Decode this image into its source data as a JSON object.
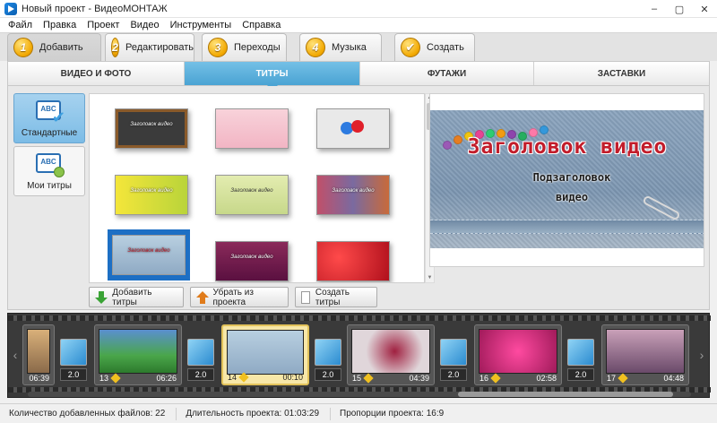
{
  "window": {
    "title": "Новый проект - ВидеоМОНТАЖ",
    "minimize": "–",
    "maximize": "▢",
    "close": "✕"
  },
  "menu": [
    "Файл",
    "Правка",
    "Проект",
    "Видео",
    "Инструменты",
    "Справка"
  ],
  "steps": [
    {
      "num": "1",
      "label": "Добавить"
    },
    {
      "num": "2",
      "label": "Редактировать"
    },
    {
      "num": "3",
      "label": "Переходы"
    },
    {
      "num": "4",
      "label": "Музыка"
    },
    {
      "num": "✔",
      "label": "Создать"
    }
  ],
  "categories": [
    "ВИДЕО И ФОТО",
    "ТИТРЫ",
    "ФУТАЖИ",
    "ЗАСТАВКИ"
  ],
  "active_category": "ТИТРЫ",
  "sidebar": [
    {
      "label": "Стандартные",
      "icon_text": "ABC",
      "active": true
    },
    {
      "label": "Мои титры",
      "icon_text": "ABC",
      "active": false
    }
  ],
  "thumbnails": [
    {
      "caption": "Заголовок видео",
      "bg": "#3b3b3b"
    },
    {
      "caption": "",
      "bg": "#f6c6d0"
    },
    {
      "caption": "",
      "bg": "#e9e9e9"
    },
    {
      "caption": "Заголовок видео",
      "bg": "#d8e030"
    },
    {
      "caption": "Заголовок видео",
      "bg": "#d9e6a0"
    },
    {
      "caption": "Заголовок видео",
      "bg": "#b84a6a"
    },
    {
      "caption": "Заголовок видео",
      "bg": "#a9c4da"
    },
    {
      "caption": "Заголовок видео",
      "bg": "#7a1a4a"
    },
    {
      "caption": "",
      "bg": "#c2202c"
    }
  ],
  "preview": {
    "title": "Заголовок видео",
    "subtitle_line1": "Подзаголовок",
    "subtitle_line2": "видео"
  },
  "buttons": {
    "add_titles": "Добавить титры",
    "remove_from_project": "Убрать из проекта",
    "create_titles": "Создать титры"
  },
  "timeline": {
    "clips": [
      {
        "num": "",
        "time": "06:39",
        "bg": "#c7a07a"
      },
      {
        "num": "13",
        "time": "06:26",
        "bg": "#5aa65a"
      },
      {
        "num": "14",
        "time": "00:10",
        "bg": "#a9c4da"
      },
      {
        "num": "15",
        "time": "04:39",
        "bg": "#d9d2d6"
      },
      {
        "num": "16",
        "time": "02:58",
        "bg": "#c8327a"
      },
      {
        "num": "17",
        "time": "04:48",
        "bg": "#9b6b8a"
      }
    ],
    "transitions": [
      "2.0",
      "2.0",
      "2.0",
      "2.0",
      "2.0"
    ],
    "left_arrow": "‹",
    "right_arrow": "›"
  },
  "status": {
    "files_added": "Количество добавленных файлов: 22",
    "duration": "Длительность проекта: 01:03:29",
    "aspect": "Пропорции проекта: 16:9"
  },
  "colors": {
    "accent": "#4aa3d3",
    "step_badge": "#f2a800",
    "timeline_bg": "#3a3a3a"
  }
}
